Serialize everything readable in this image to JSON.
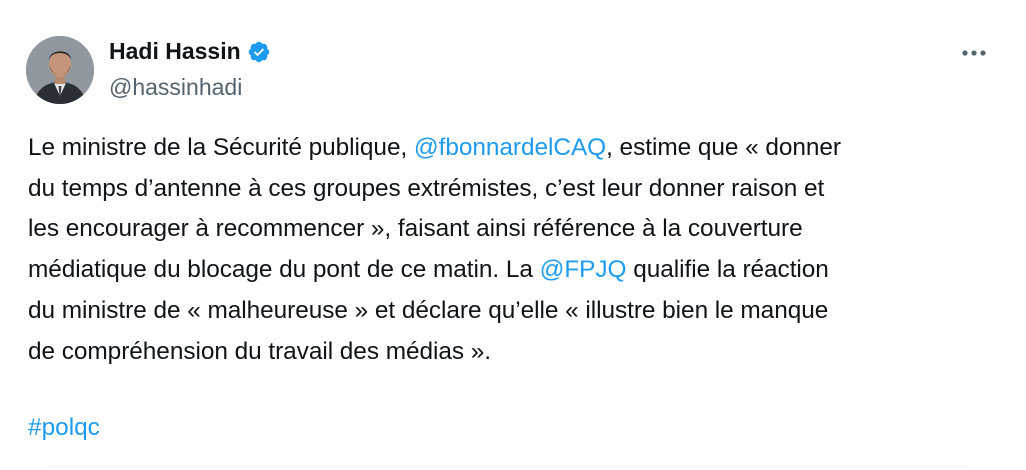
{
  "author": {
    "display_name": "Hadi Hassin",
    "handle": "@hassinhadi",
    "verified_icon": "verified-badge-icon",
    "avatar_icon": "avatar-photo"
  },
  "actions": {
    "more_icon": "more-options-icon"
  },
  "tweet": {
    "lines": [
      {
        "before": "Le ministre de la Sécurité publique, ",
        "mention": "@fbonnardelCAQ",
        "after": ", estime que « donner"
      },
      {
        "text": "du temps d’antenne à ces groupes extrémistes, c’est leur donner raison et"
      },
      {
        "text": "les encourager à recommencer », faisant ainsi référence à la couverture"
      },
      {
        "before": "médiatique du blocage du pont de ce matin. La ",
        "mention": "@FPJQ",
        "after": " qualifie la réaction"
      },
      {
        "text": "du ministre de « malheureuse » et déclare qu’elle « illustre bien le manque"
      },
      {
        "text": "de compréhension du travail des médias »."
      }
    ],
    "hashtag": "#polqc"
  },
  "colors": {
    "link": "#1d9bf0",
    "text": "#0f1419",
    "secondary": "#536471",
    "verified": "#1d9bf0"
  }
}
